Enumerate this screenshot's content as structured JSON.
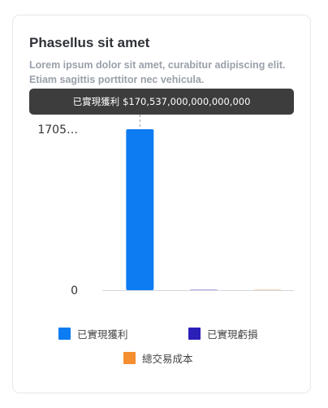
{
  "card": {
    "title": "Phasellus sit amet",
    "description": "Lorem ipsum dolor sit amet, curabitur adipiscing elit. Etiam sagittis porttitor nec vehicula."
  },
  "tooltip": {
    "label": "已實現獲利",
    "value": "$170,537,000,000,000,000"
  },
  "chart_data": {
    "type": "bar",
    "categories": [
      "已實現獲利",
      "已實現虧損",
      "總交易成本"
    ],
    "values": [
      170537000000000000,
      0,
      0
    ],
    "colors": [
      "#0d7cf2",
      "#2b1fb8",
      "#f58e2e"
    ],
    "ylim": [
      0,
      170537000000000000
    ],
    "y_ticks": [
      "0",
      "1705…"
    ],
    "legend": [
      {
        "name": "已實現獲利",
        "color": "#0d7cf2"
      },
      {
        "name": "已實現虧損",
        "color": "#2b1fb8"
      },
      {
        "name": "總交易成本",
        "color": "#f58e2e"
      }
    ],
    "legend_position": "bottom",
    "grid": false
  }
}
